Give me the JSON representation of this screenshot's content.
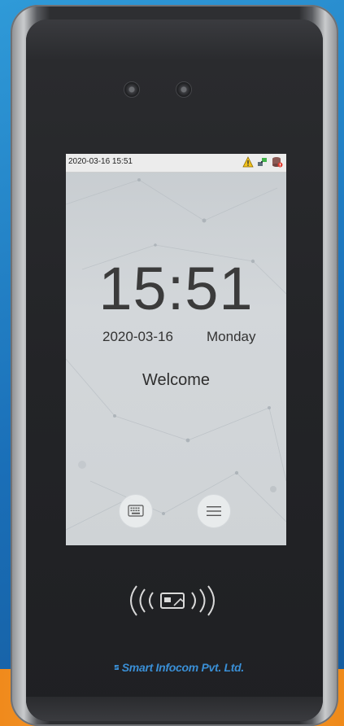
{
  "status_bar": {
    "datetime": "2020-03-16  15:51",
    "icons": [
      "warning-icon",
      "network-icon",
      "database-alert-icon"
    ]
  },
  "home": {
    "time": "15:51",
    "date": "2020-03-16",
    "day": "Monday",
    "greeting": "Welcome"
  },
  "buttons": {
    "keyboard": "keyboard-icon",
    "menu": "menu-icon"
  },
  "device": {
    "card_reader_icon": "rfid-card-icon",
    "brand": "Smart Infocom Pvt. Ltd.",
    "brand_color": "#3a8fd6"
  }
}
